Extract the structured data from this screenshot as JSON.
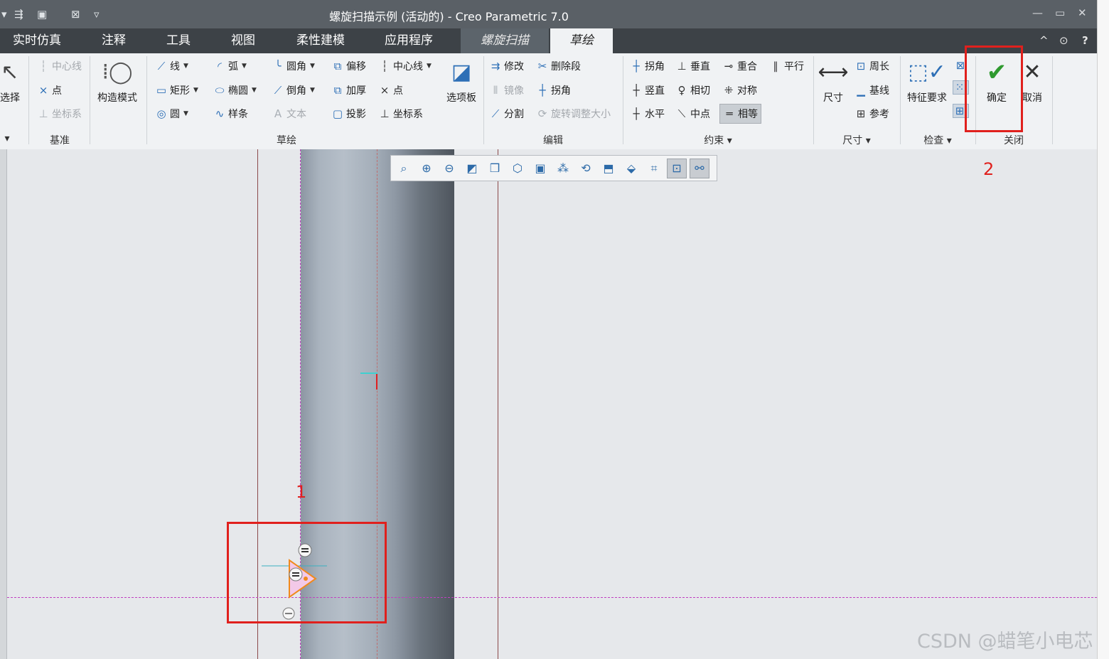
{
  "window": {
    "title": "螺旋扫描示例 (活动的) - Creo Parametric 7.0",
    "quick_access": [
      "▾",
      "⇶",
      "▣",
      "⊠",
      "▿"
    ],
    "controls": [
      "—",
      "▭",
      "✕"
    ]
  },
  "tabs": [
    {
      "label": "实时仿真"
    },
    {
      "label": "注释"
    },
    {
      "label": "工具"
    },
    {
      "label": "视图"
    },
    {
      "label": "柔性建模"
    },
    {
      "label": "应用程序"
    },
    {
      "label": "螺旋扫描"
    },
    {
      "label": "草绘"
    }
  ],
  "tab_icons": [
    "^",
    "⊙",
    "?"
  ],
  "ribbon": {
    "select": {
      "label": "选择",
      "group_label": "▾"
    },
    "datum": {
      "label": "基准",
      "items": [
        "中心线",
        "点",
        "坐标系"
      ]
    },
    "construction": {
      "label": "构造模式"
    },
    "sketch": {
      "label": "草绘",
      "items": [
        "线",
        "弧",
        "圆角",
        "偏移",
        "中心线",
        "矩形",
        "椭圆",
        "倒角",
        "加厚",
        "点",
        "圆",
        "样条",
        "文本",
        "投影",
        "坐标系"
      ],
      "palette": "选项板"
    },
    "edit": {
      "label": "编辑",
      "items": [
        "修改",
        "删除段",
        "镜像",
        "拐角",
        "分割",
        "旋转调整大小"
      ]
    },
    "constrain": {
      "label": "约束 ▾",
      "items": [
        "拐角",
        "垂直",
        "重合",
        "平行",
        "竖直",
        "相切",
        "对称",
        "水平",
        "中点",
        "相等"
      ]
    },
    "dimension": {
      "label": "尺寸 ▾",
      "big": "尺寸",
      "items": [
        "周长",
        "基线",
        "参考"
      ]
    },
    "inspect": {
      "label": "检查 ▾",
      "big": "特征要求"
    },
    "close": {
      "label": "关闭",
      "ok": "确定",
      "cancel": "取消"
    }
  },
  "annotations": {
    "one": "1",
    "two": "2"
  },
  "watermark": "CSDN @蜡笔小电芯",
  "colors": {
    "title_bar": "#5a6066",
    "tab_bar": "#3d4247",
    "highlight": "#e0201d",
    "ok_check": "#2f9a2f"
  }
}
